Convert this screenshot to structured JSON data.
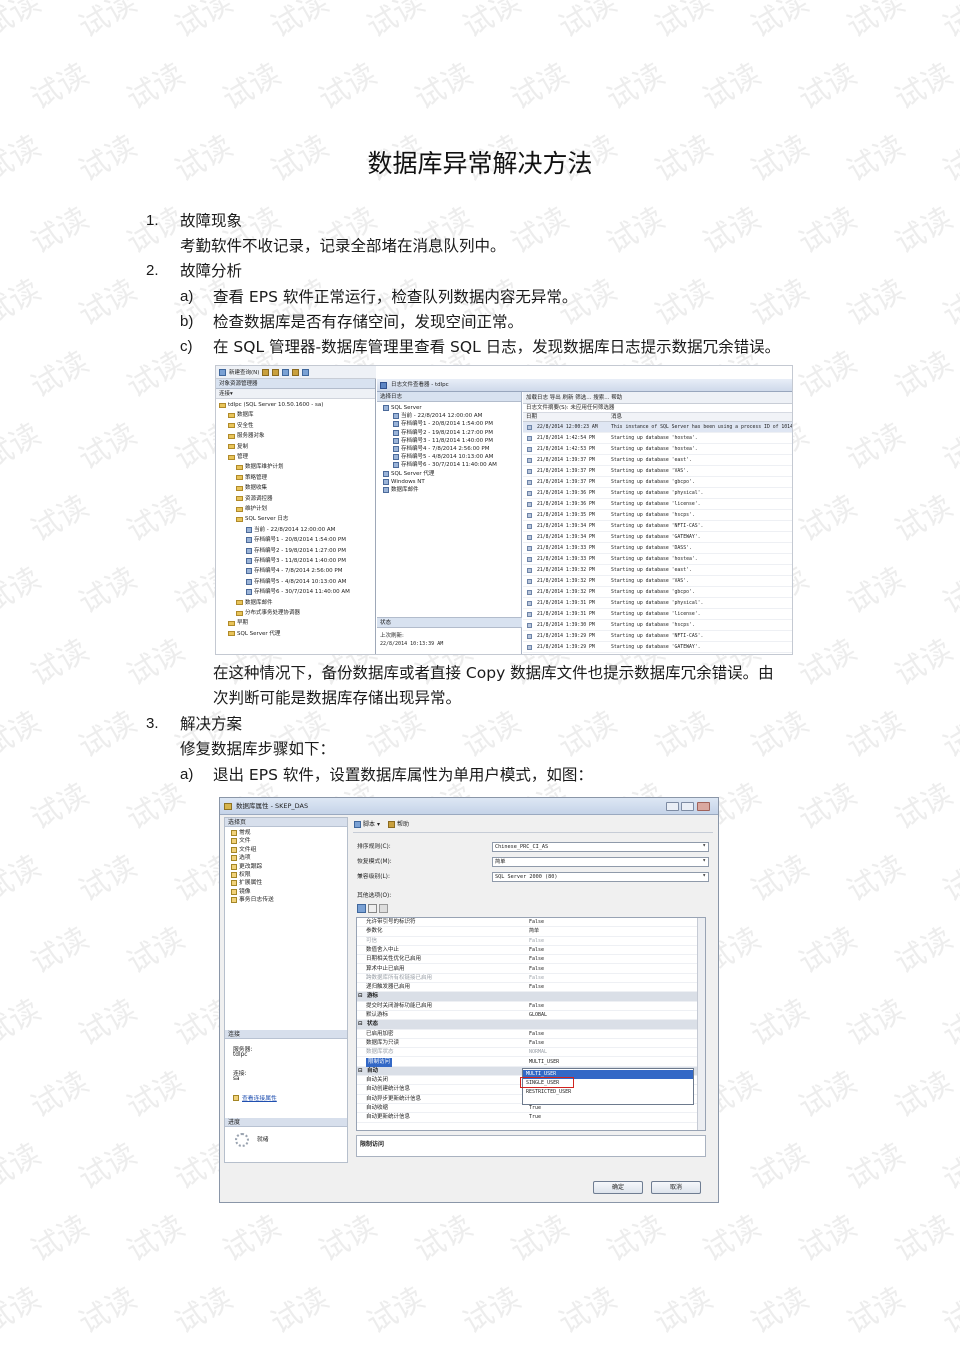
{
  "watermark_text": "试读",
  "title": "数据库异常解决方法",
  "sections": {
    "s1": {
      "num": "1.",
      "heading": "故障现象",
      "body": "考勤软件不收记录，记录全部堵在消息队列中。"
    },
    "s2": {
      "num": "2.",
      "heading": "故障分析",
      "items": [
        {
          "mark": "a)",
          "text": "查看 EPS 软件正常运行，检查队列数据内容无异常。"
        },
        {
          "mark": "b)",
          "text": "检查数据库是否有存储空间，发现空间正常。"
        },
        {
          "mark": "c)",
          "text": "在 SQL 管理器-数据库管理里查看 SQL 日志，发现数据库日志提示数据冗余错误。"
        }
      ],
      "after_line1": "在这种情况下，备份数据库或者直接 Copy 数据库文件也提示数据库冗余错误。由",
      "after_line2": "次判断可能是数据库存储出现异常。"
    },
    "s3": {
      "num": "3.",
      "heading": "解决方案",
      "body": "修复数据库步骤如下：",
      "items": [
        {
          "mark": "a)",
          "text": "退出 EPS 软件，设置数据库属性为单用户模式，如图："
        }
      ]
    }
  },
  "screenshot1": {
    "toolbar_label": "新建查询(N)",
    "oe_title": "对象资源管理器",
    "oe_connect": "连接▾",
    "tree": [
      "tdlpc (SQL Server 10.50.1600 - sa)",
      "数据库",
      "安全性",
      "服务器对象",
      "复制",
      "管理",
      "数据库维护计划",
      "策略管理",
      "数据收集",
      "资源调控器",
      "维护计划",
      "SQL Server 日志",
      "当前 - 22/8/2014 12:00:00 AM",
      "存档编号1 - 20/8/2014 1:54:00 PM",
      "存档编号2 - 19/8/2014 1:27:00 PM",
      "存档编号3 - 11/8/2014 1:40:00 PM",
      "存档编号4 - 7/8/2014 2:56:00 PM",
      "存档编号5 - 4/8/2014 10:13:00 AM",
      "存档编号6 - 30/7/2014 11:40:00 AM",
      "数据库邮件",
      "分布式事务处理协调器",
      "早期",
      "SQL Server 代理"
    ],
    "viewer_title": "日志文件查看器 - tdlpc",
    "select_logs": "选择日志",
    "log_tree": [
      "SQL Server",
      "当前 - 22/8/2014 12:00:00 AM",
      "存档编号1 - 20/8/2014 1:54:00 PM",
      "存档编号2 - 19/8/2014 1:27:00 PM",
      "存档编号3 - 11/8/2014 1:40:00 PM",
      "存档编号4 - 7/8/2014 2:56:00 PM",
      "存档编号5 - 4/8/2014 10:13:00 AM",
      "存档编号6 - 30/7/2014 11:40:00 AM",
      "SQL Server 代理",
      "Windows NT",
      "数据库邮件"
    ],
    "status_label": "状态",
    "last_refresh_label": "上次刷新:",
    "last_refresh_value": "22/8/2014 10:13:39 AM",
    "right_toolbar": "加载日志   导出   刷新   筛选...   搜索...   帮助",
    "right_info": "日志文件摘要(S): 未应用任何筛选器",
    "col_date": "日期",
    "col_message": "消息",
    "rows": [
      {
        "d": "22/8/2014 12:00:23 AM",
        "m": "This instance of SQL Server has been using a process ID of 1014 si"
      },
      {
        "d": "21/8/2014 1:42:54 PM",
        "m": "Starting up database 'hostea'."
      },
      {
        "d": "21/8/2014 1:42:53 PM",
        "m": "Starting up database 'hostea'."
      },
      {
        "d": "21/8/2014 1:39:37 PM",
        "m": "Starting up database 'east'."
      },
      {
        "d": "21/8/2014 1:39:37 PM",
        "m": "Starting up database 'VAS'."
      },
      {
        "d": "21/8/2014 1:39:37 PM",
        "m": "Starting up database 'gbcpo'."
      },
      {
        "d": "21/8/2014 1:39:36 PM",
        "m": "Starting up database 'physical'."
      },
      {
        "d": "21/8/2014 1:39:36 PM",
        "m": "Starting up database 'license'."
      },
      {
        "d": "21/8/2014 1:39:35 PM",
        "m": "Starting up database 'hscps'."
      },
      {
        "d": "21/8/2014 1:39:34 PM",
        "m": "Starting up database 'NFTI-CAS'."
      },
      {
        "d": "21/8/2014 1:39:34 PM",
        "m": "Starting up database 'GATEWAY'."
      },
      {
        "d": "21/8/2014 1:39:33 PM",
        "m": "Starting up database 'DASS'."
      },
      {
        "d": "21/8/2014 1:39:33 PM",
        "m": "Starting up database 'hostea'."
      },
      {
        "d": "21/8/2014 1:39:32 PM",
        "m": "Starting up database 'east'."
      },
      {
        "d": "21/8/2014 1:39:32 PM",
        "m": "Starting up database 'VAS'."
      },
      {
        "d": "21/8/2014 1:39:32 PM",
        "m": "Starting up database 'gbcpo'."
      },
      {
        "d": "21/8/2014 1:39:31 PM",
        "m": "Starting up database 'physical'."
      },
      {
        "d": "21/8/2014 1:39:31 PM",
        "m": "Starting up database 'license'."
      },
      {
        "d": "21/8/2014 1:39:30 PM",
        "m": "Starting up database 'hscps'."
      },
      {
        "d": "21/8/2014 1:39:29 PM",
        "m": "Starting up database 'NFTI-CAS'."
      },
      {
        "d": "21/8/2014 1:39:29 PM",
        "m": "Starting up database 'GATEWAY'."
      }
    ]
  },
  "screenshot2": {
    "title": "数据库属性 - SKEP_DAS",
    "select_page": "选择页",
    "pages": [
      "常规",
      "文件",
      "文件组",
      "选项",
      "更改跟踪",
      "权限",
      "扩展属性",
      "镜像",
      "事务日志传送"
    ],
    "connection_header": "连接",
    "server_label": "服务器:",
    "server_value": "tdlpc",
    "connect_label": "连接:",
    "connect_value": "sa",
    "view_conn_props": "查看连接属性",
    "progress_header": "进度",
    "progress_value": "就绪",
    "toolbar_script": "脚本",
    "toolbar_help": "帮助",
    "collation_label": "排序规则(C):",
    "collation_value": "Chinese_PRC_CI_AS",
    "recovery_label": "恢复模式(M):",
    "recovery_value": "简单",
    "compat_label": "兼容级别(L):",
    "compat_value": "SQL Server 2000 (80)",
    "other_options_label": "其他选项(O):",
    "grid": [
      {
        "k": "允许带引号的标识符",
        "v": "False",
        "t": "row"
      },
      {
        "k": "参数化",
        "v": "简单",
        "t": "row"
      },
      {
        "k": "可信",
        "v": "False",
        "t": "dis"
      },
      {
        "k": "数值舍入中止",
        "v": "False",
        "t": "row"
      },
      {
        "k": "日期相关性优化已启用",
        "v": "False",
        "t": "row"
      },
      {
        "k": "算术中止已启用",
        "v": "False",
        "t": "row"
      },
      {
        "k": "跨数据库所有权链接已启用",
        "v": "False",
        "t": "dis"
      },
      {
        "k": "递归触发器已启用",
        "v": "False",
        "t": "row"
      },
      {
        "k": "游标",
        "v": "",
        "t": "cat"
      },
      {
        "k": "提交时关闭游标功能已启用",
        "v": "False",
        "t": "row"
      },
      {
        "k": "默认游标",
        "v": "GLOBAL",
        "t": "row"
      },
      {
        "k": "状态",
        "v": "",
        "t": "cat"
      },
      {
        "k": "已启用加密",
        "v": "False",
        "t": "row"
      },
      {
        "k": "数据库为只读",
        "v": "False",
        "t": "row"
      },
      {
        "k": "数据库状态",
        "v": "NORMAL",
        "t": "dis"
      },
      {
        "k": "限制访问",
        "v": "MULTI_USER",
        "t": "sel"
      },
      {
        "k": "自动",
        "v": "",
        "t": "cat"
      },
      {
        "k": "自动关闭",
        "v": "",
        "t": "row"
      },
      {
        "k": "自动创建统计信息",
        "v": "",
        "t": "row"
      },
      {
        "k": "自动异步更新统计信息",
        "v": "False",
        "t": "row"
      },
      {
        "k": "自动收缩",
        "v": "True",
        "t": "row"
      },
      {
        "k": "自动更新统计信息",
        "v": "True",
        "t": "row"
      }
    ],
    "dropdown_options": [
      "MULTI_USER",
      "SINGLE_USER",
      "RESTRICTED_USER"
    ],
    "description_title": "限制访问",
    "ok_button": "确定",
    "cancel_button": "取消"
  }
}
